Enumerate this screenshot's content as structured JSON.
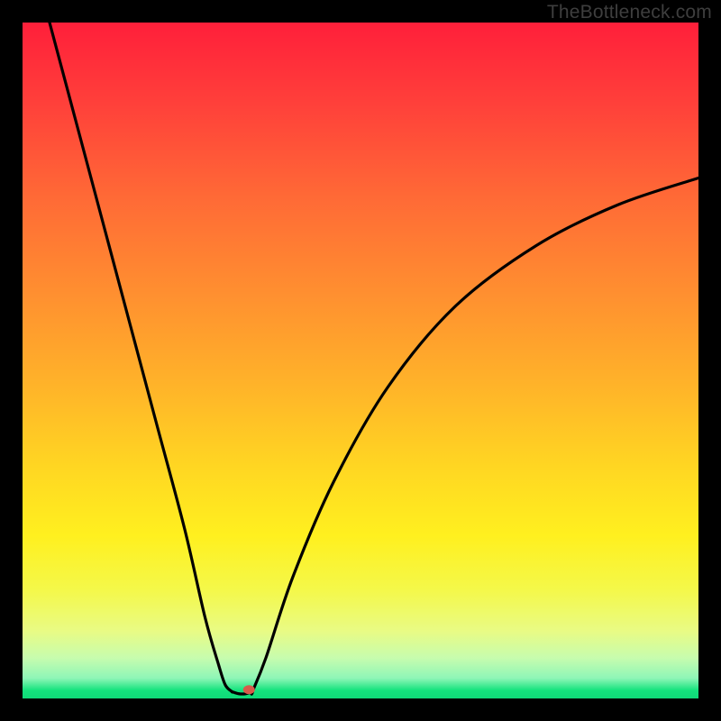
{
  "watermark": {
    "text": "TheBottleneck.com"
  },
  "colors": {
    "frame_bg": "#000000",
    "curve": "#000000",
    "marker": "#d85a4a",
    "gradient_stops": [
      "#ff1f3a",
      "#ff403a",
      "#ff6a36",
      "#ff8f30",
      "#ffb429",
      "#ffd722",
      "#fff01f",
      "#f4f84a",
      "#e9fb84",
      "#c7fcae",
      "#8ef6b7",
      "#14e37d",
      "#0fd978"
    ]
  },
  "chart_data": {
    "type": "line",
    "title": "",
    "xlabel": "",
    "ylabel": "",
    "xlim": [
      0,
      100
    ],
    "ylim": [
      0,
      100
    ],
    "grid": false,
    "legend": false,
    "series": [
      {
        "name": "left-branch",
        "x": [
          4,
          8,
          12,
          16,
          20,
          24,
          27,
          29,
          30,
          31
        ],
        "y": [
          100,
          85,
          70,
          55,
          40,
          25,
          12,
          5,
          2,
          1
        ]
      },
      {
        "name": "flat-bottom",
        "x": [
          31,
          32,
          33,
          34
        ],
        "y": [
          1,
          0.7,
          0.7,
          1
        ]
      },
      {
        "name": "right-branch",
        "x": [
          34,
          36,
          40,
          46,
          54,
          64,
          76,
          88,
          100
        ],
        "y": [
          1,
          6,
          18,
          32,
          46,
          58,
          67,
          73,
          77
        ]
      }
    ],
    "marker_point": {
      "x": 33.5,
      "y": 1.3
    }
  }
}
